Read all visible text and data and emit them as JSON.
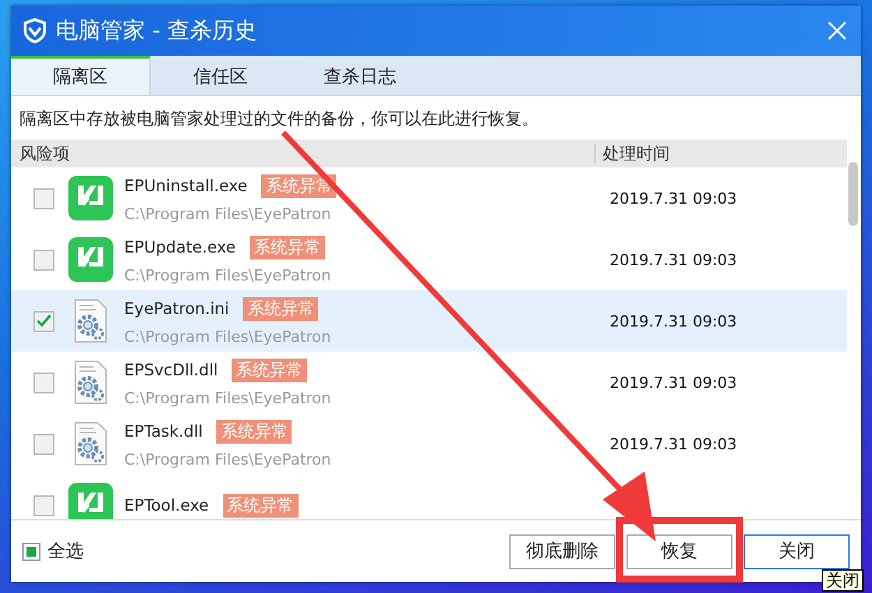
{
  "window": {
    "title": "电脑管家 - 查杀历史"
  },
  "tabs": [
    {
      "label": "隔离区",
      "selected": true
    },
    {
      "label": "信任区",
      "selected": false
    },
    {
      "label": "查杀日志",
      "selected": false
    }
  ],
  "description": "隔离区中存放被电脑管家处理过的文件的备份，你可以在此进行恢复。",
  "table": {
    "columns": [
      "风险项",
      "处理时间"
    ],
    "rows": [
      {
        "kind": "app",
        "checked": false,
        "selected": false,
        "name": "EPUninstall.exe",
        "tag": "系统异常",
        "path": "C:\\Program Files\\EyePatron",
        "time": "2019.7.31 09:03"
      },
      {
        "kind": "app",
        "checked": false,
        "selected": false,
        "name": "EPUpdate.exe",
        "tag": "系统异常",
        "path": "C:\\Program Files\\EyePatron",
        "time": "2019.7.31 09:03"
      },
      {
        "kind": "config",
        "checked": true,
        "selected": true,
        "name": "EyePatron.ini",
        "tag": "系统异常",
        "path": "C:\\Program Files\\EyePatron",
        "time": "2019.7.31 09:03"
      },
      {
        "kind": "config",
        "checked": false,
        "selected": false,
        "name": "EPSvcDll.dll",
        "tag": "系统异常",
        "path": "C:\\Program Files\\EyePatron",
        "time": "2019.7.31 09:03"
      },
      {
        "kind": "config",
        "checked": false,
        "selected": false,
        "name": "EPTask.dll",
        "tag": "系统异常",
        "path": "C:\\Program Files\\EyePatron",
        "time": "2019.7.31 09:03"
      },
      {
        "kind": "app",
        "checked": false,
        "selected": false,
        "name": "EPTool.exe",
        "tag": "系统异常"
      }
    ]
  },
  "select_all": {
    "label": "全选",
    "indeterminate": true
  },
  "buttons": [
    {
      "label": "彻底删除",
      "kind": "normal"
    },
    {
      "label": "恢复",
      "kind": "normal"
    },
    {
      "label": "关闭",
      "kind": "default"
    }
  ],
  "tooltip": "关闭"
}
